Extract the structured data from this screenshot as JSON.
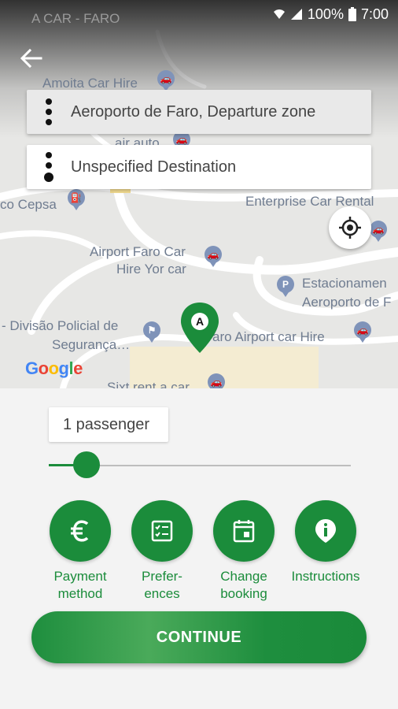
{
  "status_bar": {
    "battery": "100%",
    "time": "7:00"
  },
  "map": {
    "labels": {
      "top_faded": "A CAR - FARO",
      "amoita": "Amoita Car Hire",
      "air_auto": "air auto",
      "cepsa": "co Cepsa",
      "enterprise": "Enterprise Car Rental",
      "airport_faro": "Airport Faro Car",
      "hire_yor": "Hire Yor car",
      "estacionamento": "Estacionamen",
      "aeroporto_de": "Aeroporto de F",
      "divisao": "- Divisão Policial de",
      "seguranca": "Segurança…",
      "faro_airport": "aro Airport car Hire",
      "sixt": "Sixt rent a car"
    },
    "marker_letter": "A",
    "attribution": "Google"
  },
  "route": {
    "origin": "Aeroporto de Faro, Departure zone",
    "destination": "Unspecified Destination"
  },
  "booking": {
    "passengers_label": "1 passenger",
    "slider_level": 0.125
  },
  "actions": [
    {
      "label": "Payment\nmethod",
      "icon": "euro-icon"
    },
    {
      "label": "Prefer-\nences",
      "icon": "checklist-icon"
    },
    {
      "label": "Change\nbooking",
      "icon": "calendar-icon"
    },
    {
      "label": "Instructions",
      "icon": "info-icon"
    }
  ],
  "continue_label": "CONTINUE",
  "colors": {
    "primary": "#1b8c3b",
    "poi": "#7f93b9"
  }
}
